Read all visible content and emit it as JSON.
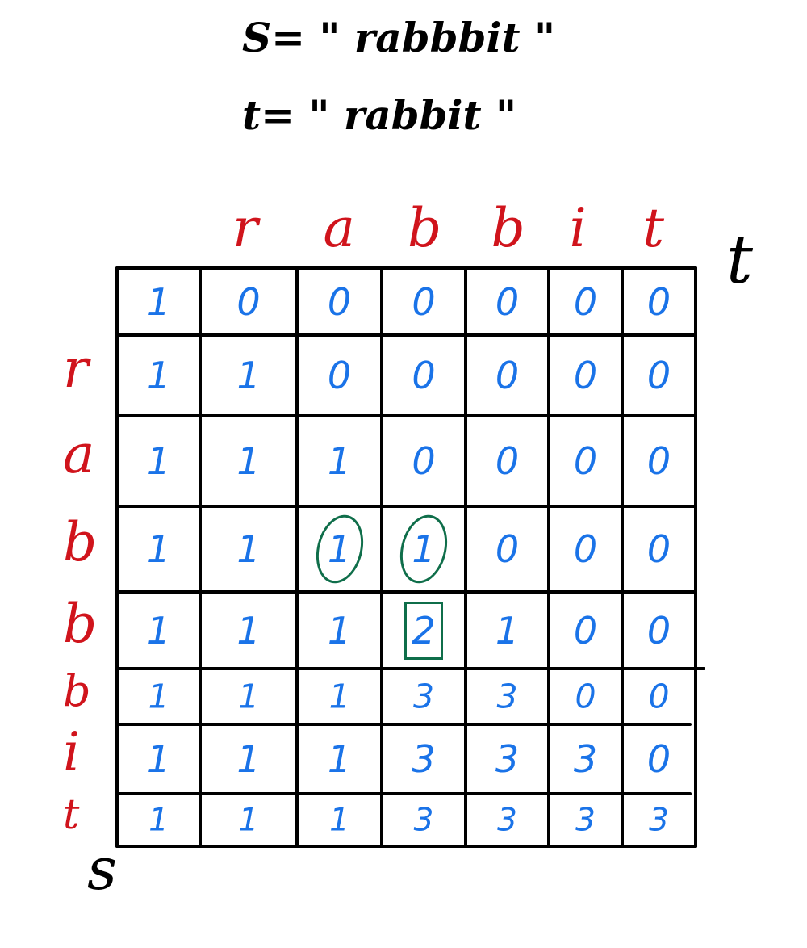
{
  "definitions": {
    "s": "S= \" rabbbit \"",
    "t": "t= \" rabbit \""
  },
  "axis_labels": {
    "t": "t",
    "s": "s"
  },
  "column_headers": [
    "r",
    "a",
    "b",
    "b",
    "i",
    "t"
  ],
  "row_headers": [
    "r",
    "a",
    "b",
    "b",
    "b",
    "i",
    "t"
  ],
  "dp_table": [
    [
      "1",
      "0",
      "0",
      "0",
      "0",
      "0",
      "0"
    ],
    [
      "1",
      "1",
      "0",
      "0",
      "0",
      "0",
      "0"
    ],
    [
      "1",
      "1",
      "1",
      "0",
      "0",
      "0",
      "0"
    ],
    [
      "1",
      "1",
      "1",
      "1",
      "0",
      "0",
      "0"
    ],
    [
      "1",
      "1",
      "1",
      "2",
      "1",
      "0",
      "0"
    ],
    [
      "1",
      "1",
      "1",
      "3",
      "3",
      "0",
      "0"
    ],
    [
      "1",
      "1",
      "1",
      "3",
      "3",
      "3",
      "0"
    ],
    [
      "1",
      "1",
      "1",
      "3",
      "3",
      "3",
      "3"
    ]
  ],
  "highlights": {
    "circled_cells": [
      [
        3,
        2
      ],
      [
        3,
        3
      ]
    ],
    "boxed_cells": [
      [
        4,
        3
      ]
    ]
  },
  "colors": {
    "ink": "#000000",
    "labels": "#d0141c",
    "values": "#1a73e8",
    "highlight": "#0f6e4a"
  }
}
